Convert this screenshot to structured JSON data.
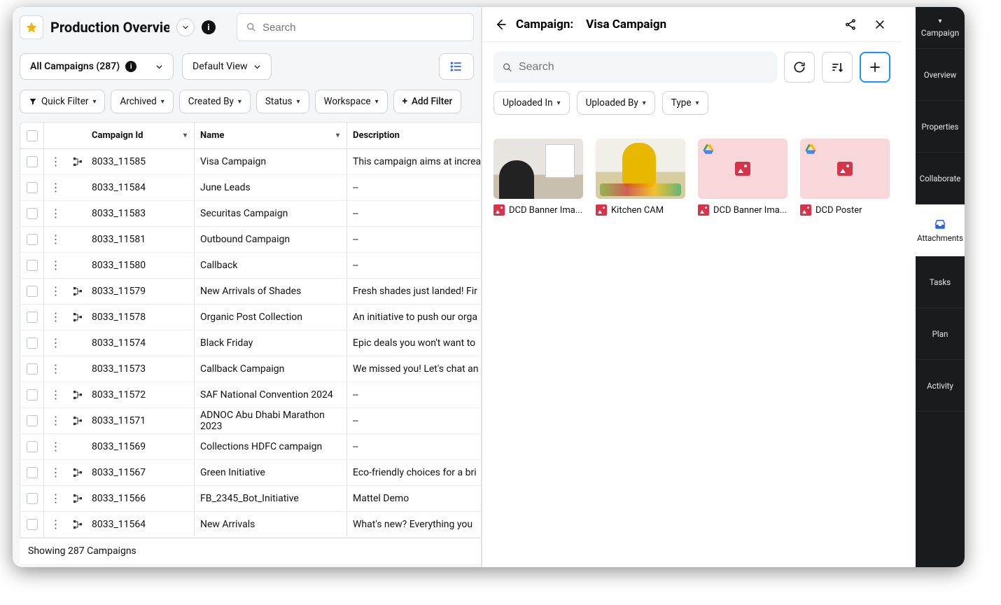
{
  "header": {
    "title": "Production Overview",
    "search_placeholder": "Search"
  },
  "subtoolbar": {
    "all_campaigns_label": "All Campaigns (287)",
    "default_view_label": "Default View"
  },
  "filters": {
    "quick_filter": "Quick Filter",
    "archived": "Archived",
    "created_by": "Created By",
    "status": "Status",
    "workspace": "Workspace",
    "add_filter": "Add Filter"
  },
  "table": {
    "headers": {
      "id": "Campaign Id",
      "name": "Name",
      "desc": "Description"
    },
    "rows": [
      {
        "id": "8033_11585",
        "name": "Visa Campaign",
        "desc": "This campaign aims at increa",
        "hier": true
      },
      {
        "id": "8033_11584",
        "name": "June Leads",
        "desc": "--",
        "hier": false
      },
      {
        "id": "8033_11583",
        "name": "Securitas Campaign",
        "desc": "--",
        "hier": false
      },
      {
        "id": "8033_11581",
        "name": "Outbound Campaign",
        "desc": "--",
        "hier": false
      },
      {
        "id": "8033_11580",
        "name": "Callback",
        "desc": "--",
        "hier": false
      },
      {
        "id": "8033_11579",
        "name": "New Arrivals of Shades",
        "desc": "Fresh shades just landed! Fir",
        "hier": true
      },
      {
        "id": "8033_11578",
        "name": "Organic Post Collection",
        "desc": "An initiative to push our orga",
        "hier": true
      },
      {
        "id": "8033_11574",
        "name": "Black Friday",
        "desc": "Epic deals you won't want to",
        "hier": false
      },
      {
        "id": "8033_11573",
        "name": "Callback Campaign",
        "desc": "We missed you! Let's chat an",
        "hier": false
      },
      {
        "id": "8033_11572",
        "name": "SAF National Convention 2024",
        "desc": "--",
        "hier": true
      },
      {
        "id": "8033_11571",
        "name": "ADNOC Abu Dhabi Marathon 2023",
        "desc": "--",
        "hier": true
      },
      {
        "id": "8033_11569",
        "name": "Collections HDFC campaign",
        "desc": "--",
        "hier": false
      },
      {
        "id": "8033_11567",
        "name": "Green Initiative",
        "desc": "Eco-friendly choices for a bri",
        "hier": true
      },
      {
        "id": "8033_11566",
        "name": "FB_2345_Bot_Initiative",
        "desc": "Mattel Demo",
        "hier": true
      },
      {
        "id": "8033_11564",
        "name": "New Arrivals",
        "desc": "What's new? Everything you",
        "hier": true
      }
    ],
    "footer": "Showing 287 Campaigns"
  },
  "detail": {
    "title_label": "Campaign:",
    "title_name": "Visa Campaign",
    "search_placeholder": "Search",
    "filter_chips": {
      "uploaded_in": "Uploaded In",
      "uploaded_by": "Uploaded By",
      "type": "Type"
    },
    "attachments": [
      {
        "name": "DCD Banner Ima...",
        "kind": "photo1",
        "drive": false
      },
      {
        "name": "Kitchen CAM",
        "kind": "photo2",
        "drive": false
      },
      {
        "name": "DCD Banner Ima...",
        "kind": "placeholder",
        "drive": true
      },
      {
        "name": "DCD Poster",
        "kind": "placeholder",
        "drive": true
      }
    ]
  },
  "side_tabs": {
    "campaign": "Campaign",
    "overview": "Overview",
    "properties": "Properties",
    "collaborate": "Collaborate",
    "attachments": "Attachments",
    "tasks": "Tasks",
    "plan": "Plan",
    "activity": "Activity"
  }
}
